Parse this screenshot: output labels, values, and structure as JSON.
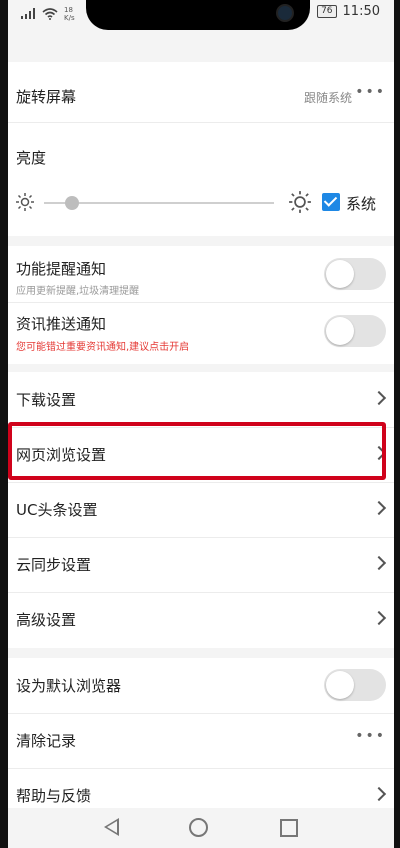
{
  "status_bar": {
    "net_speed_value": "18",
    "net_speed_unit": "K/s",
    "battery": "76",
    "time": "11:50"
  },
  "settings": {
    "rotate_screen": {
      "label": "旋转屏幕",
      "value": "跟随系统",
      "more_icon": "more-dots-icon"
    },
    "brightness": {
      "label": "亮度",
      "system_label": "系统",
      "system_checked": true,
      "level": 0.12
    },
    "feature_notify": {
      "label": "功能提醒通知",
      "sub": "应用更新提醒,垃圾清理提醒",
      "enabled": false
    },
    "news_push": {
      "label": "资讯推送通知",
      "sub": "您可能错过重要资讯通知,建议点击开启",
      "enabled": false
    },
    "download": {
      "label": "下载设置"
    },
    "web_browse": {
      "label": "网页浏览设置"
    },
    "uc_headlines": {
      "label": "UC头条设置"
    },
    "cloud_sync": {
      "label": "云同步设置"
    },
    "advanced": {
      "label": "高级设置"
    },
    "default_browser": {
      "label": "设为默认浏览器",
      "enabled": false
    },
    "clear_records": {
      "label": "清除记录"
    },
    "help_feedback": {
      "label": "帮助与反馈"
    }
  },
  "colors": {
    "accent": "#1e88e5",
    "highlight": "#d0021b",
    "warning": "#e53935"
  },
  "icons": [
    "wifi-icon",
    "signal-icon",
    "sun-icon",
    "chevron-right-icon",
    "more-dots-icon",
    "back-icon",
    "home-icon",
    "recent-apps-icon"
  ]
}
